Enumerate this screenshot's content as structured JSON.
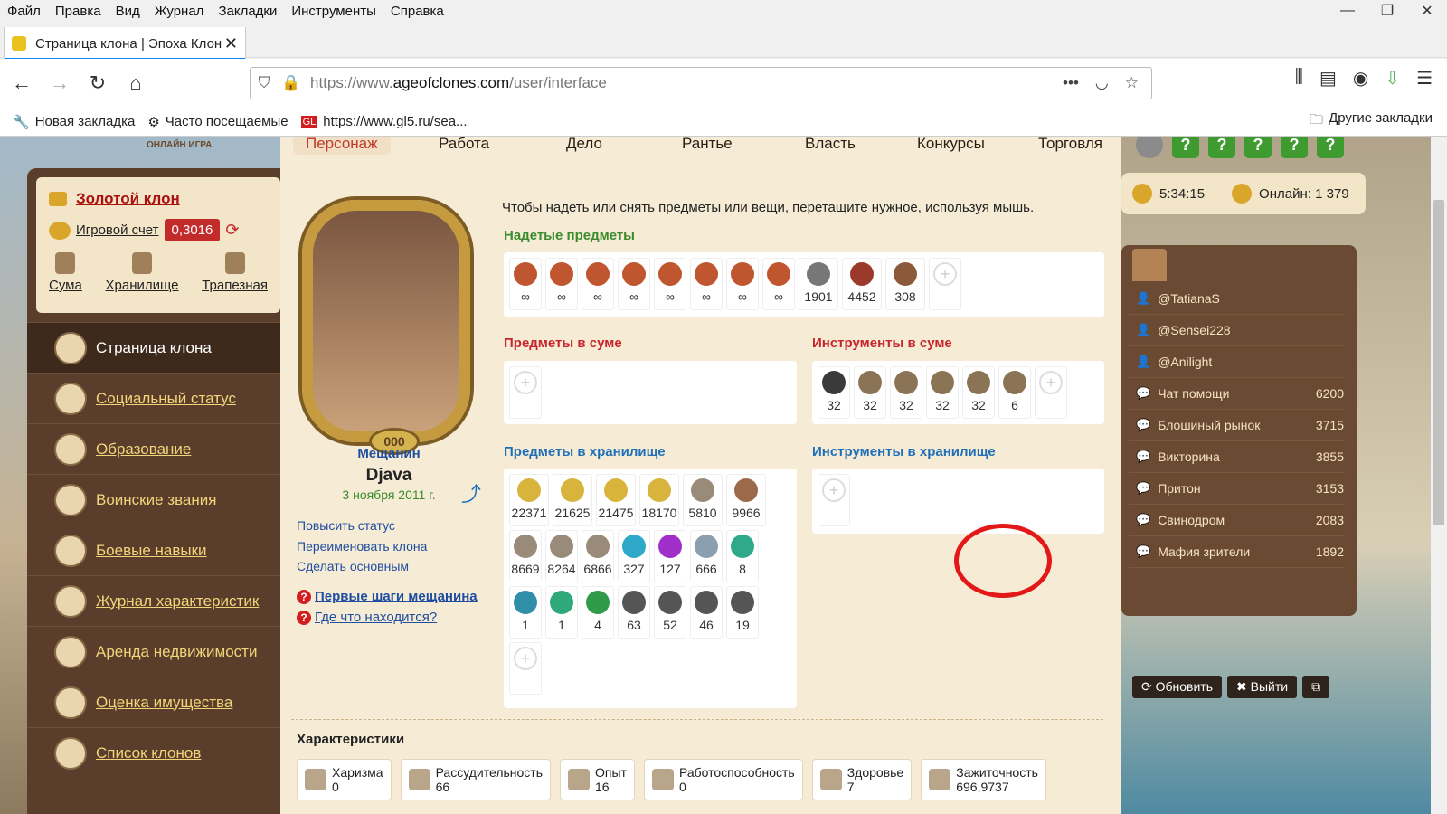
{
  "menubar": {
    "items": [
      "Файл",
      "Правка",
      "Вид",
      "Журнал",
      "Закладки",
      "Инструменты",
      "Справка"
    ]
  },
  "tab": {
    "title": "Страница клона | Эпоха Клон"
  },
  "url": {
    "prefix": "https://www.",
    "domain": "ageofclones.com",
    "path": "/user/interface"
  },
  "bookmarks": {
    "items": [
      "Новая закладка",
      "Часто посещаемые",
      "https://www.gl5.ru/sea..."
    ],
    "other": "Другие закладки"
  },
  "site": {
    "logo_text": "ЭКОНОМИЧЕСКАЯ\nОНЛАЙН ИГРА",
    "nav": [
      "Персонаж",
      "Работа",
      "Дело",
      "Рантье",
      "Власть",
      "Конкурсы",
      "Торговля"
    ],
    "help_icons": [
      "?",
      "?",
      "?",
      "?",
      "?"
    ]
  },
  "left": {
    "gold_clone": "Золотой клон",
    "account_label": "Игровой счет",
    "account_value": "0,3016",
    "quick": [
      "Сума",
      "Хранилище",
      "Трапезная"
    ],
    "menu": [
      "Страница клона",
      "Социальный статус",
      "Образование",
      "Воинские звания",
      "Боевые навыки",
      "Журнал характеристик",
      "Аренда недвижимости",
      "Оценка имущества",
      "Список клонов"
    ]
  },
  "profile": {
    "rank": "Мещанин",
    "name": "Djava",
    "date": "3 ноября 2011 г.",
    "badge": "000",
    "actions": [
      "Повысить статус",
      "Переименовать клона",
      "Сделать основным"
    ],
    "help": [
      "Первые шаги мещанина",
      "Где что находится?"
    ]
  },
  "main": {
    "instruction": "Чтобы надеть или снять предметы или вещи, перетащите нужное, используя мышь.",
    "worn_title": "Надетые предметы",
    "worn": [
      "∞",
      "∞",
      "∞",
      "∞",
      "∞",
      "∞",
      "∞",
      "∞",
      "1901",
      "4452",
      "308"
    ],
    "bag_items_title": "Предметы в суме",
    "bag_tools_title": "Инструменты в суме",
    "bag_tools": [
      "32",
      "32",
      "32",
      "32",
      "32",
      "6"
    ],
    "storage_items_title": "Предметы в хранилище",
    "storage_items": [
      "22371",
      "21625",
      "21475",
      "18170",
      "5810",
      "9966",
      "8669",
      "8264",
      "6866",
      "327",
      "127",
      "666",
      "8",
      "1",
      "1",
      "4",
      "63",
      "52",
      "46",
      "19"
    ],
    "storage_tools_title": "Инструменты в хранилище",
    "chars_title": "Характеристики",
    "chars": [
      {
        "label": "Харизма",
        "value": "0"
      },
      {
        "label": "Рассудительность",
        "value": "66"
      },
      {
        "label": "Опыт",
        "value": "16"
      },
      {
        "label": "Работоспособность",
        "value": "0"
      },
      {
        "label": "Здоровье",
        "value": "7"
      },
      {
        "label": "Зажиточность",
        "value": "696,9737"
      }
    ]
  },
  "right": {
    "time": "5:34:15",
    "online": "Онлайн: 1 379",
    "chat": [
      {
        "name": "@TatianaS",
        "count": ""
      },
      {
        "name": "@Sensei228",
        "count": ""
      },
      {
        "name": "@Anilight",
        "count": ""
      },
      {
        "name": "Чат помощи",
        "count": "6200"
      },
      {
        "name": "Блошиный рынок",
        "count": "3715"
      },
      {
        "name": "Викторина",
        "count": "3855"
      },
      {
        "name": "Притон",
        "count": "3153"
      },
      {
        "name": "Свинодром",
        "count": "2083"
      },
      {
        "name": "Мафия зрители",
        "count": "1892"
      }
    ],
    "refresh": "Обновить",
    "exit": "Выйти"
  },
  "colors": {
    "accent": "#c7252b",
    "green": "#3a8b2c",
    "blue": "#1f6fb8",
    "panel": "#5a3e2b"
  }
}
